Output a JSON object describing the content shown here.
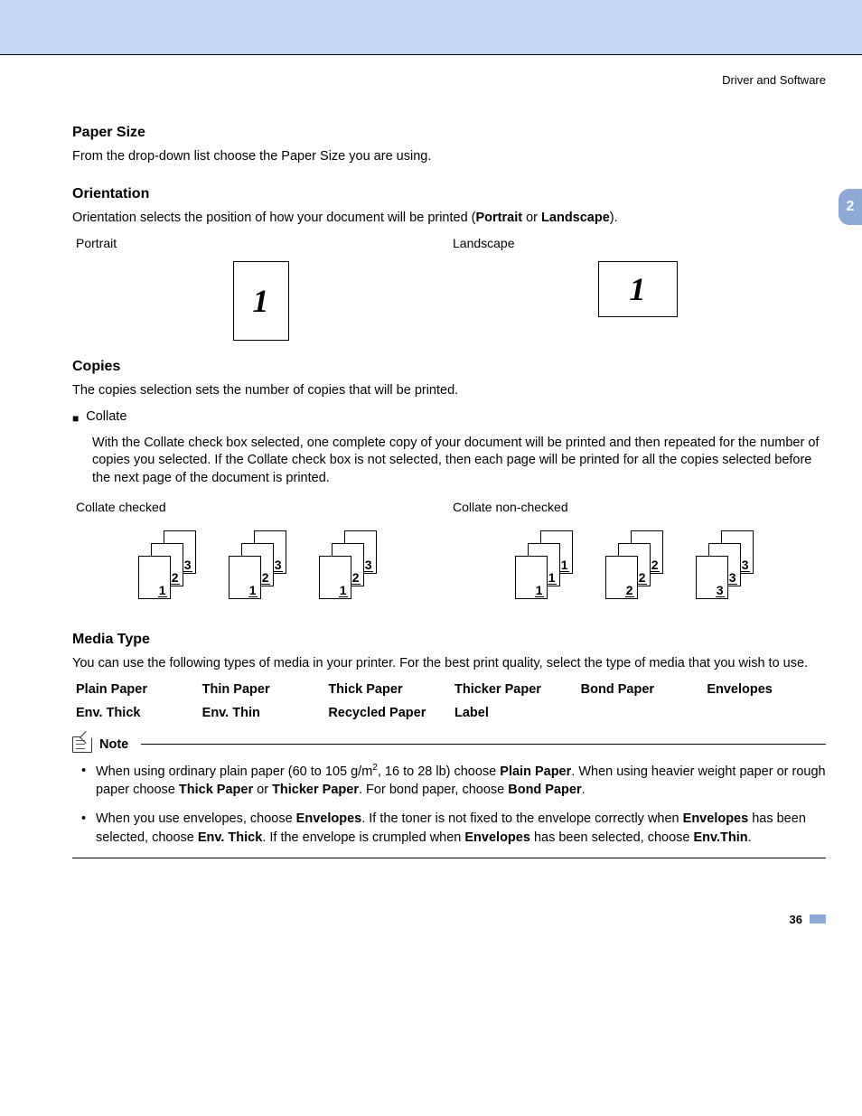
{
  "running_head": "Driver and Software",
  "chapter_tab": "2",
  "page_number": "36",
  "paper_size": {
    "heading": "Paper Size",
    "body": "From the drop-down list choose the Paper Size you are using."
  },
  "orientation": {
    "heading": "Orientation",
    "body_pre": "Orientation selects the position of how your document will be printed (",
    "body_bold1": "Portrait",
    "body_mid": " or ",
    "body_bold2": "Landscape",
    "body_post": ").",
    "portrait_label": "Portrait",
    "landscape_label": "Landscape",
    "glyph": "1"
  },
  "copies": {
    "heading": "Copies",
    "body": "The copies selection sets the number of copies that will be printed.",
    "collate_label": "Collate",
    "collate_body": "With the Collate check box selected, one complete copy of your document will be printed and then repeated for the number of copies you selected. If the Collate check box is not selected, then each page will be printed for all the copies selected before the next page of the document is printed.",
    "checked_label": "Collate checked",
    "nonchecked_label": "Collate non-checked",
    "checked_stacks": [
      [
        "1",
        "2",
        "3"
      ],
      [
        "1",
        "2",
        "3"
      ],
      [
        "1",
        "2",
        "3"
      ]
    ],
    "nonchecked_stacks": [
      [
        "1",
        "1",
        "1"
      ],
      [
        "2",
        "2",
        "2"
      ],
      [
        "3",
        "3",
        "3"
      ]
    ]
  },
  "media": {
    "heading": "Media Type",
    "body": "You can use the following types of media in your printer. For the best print quality, select the type of media that you wish to use.",
    "items": [
      "Plain Paper",
      "Thin Paper",
      "Thick Paper",
      "Thicker Paper",
      "Bond Paper",
      "Envelopes",
      "Env. Thick",
      "Env. Thin",
      "Recycled Paper",
      "Label"
    ]
  },
  "note": {
    "title": "Note",
    "n1_a": "When using ordinary plain paper (60 to 105 g/m",
    "n1_sup": "2",
    "n1_b": ", 16 to 28 lb) choose ",
    "n1_bold1": "Plain Paper",
    "n1_c": ". When using heavier weight paper or rough paper choose ",
    "n1_bold2": "Thick Paper",
    "n1_d": " or ",
    "n1_bold3": "Thicker Paper",
    "n1_e": ". For bond paper, choose ",
    "n1_bold4": "Bond Paper",
    "n1_f": ".",
    "n2_a": "When you use envelopes, choose ",
    "n2_bold1": "Envelopes",
    "n2_b": ". If the toner is not fixed to the envelope correctly when ",
    "n2_bold2": "Envelopes",
    "n2_c": " has been selected, choose ",
    "n2_bold3": "Env. Thick",
    "n2_d": ". If the envelope is crumpled when ",
    "n2_bold4": "Envelopes",
    "n2_e": " has been selected, choose ",
    "n2_bold5": "Env.Thin",
    "n2_f": "."
  }
}
